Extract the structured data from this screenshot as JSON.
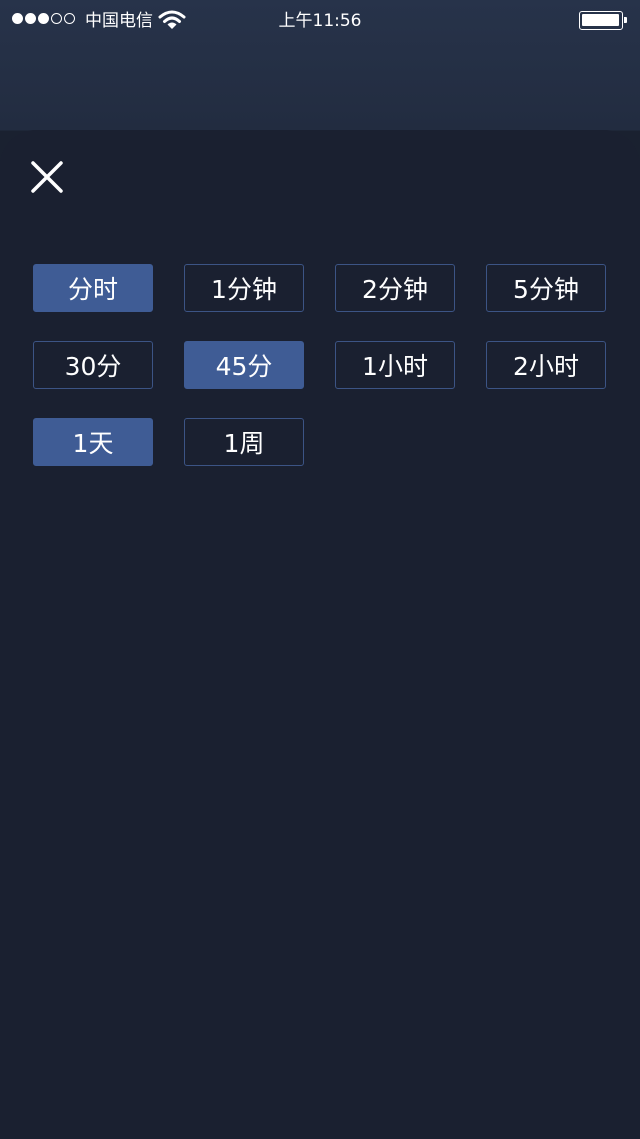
{
  "status_bar": {
    "carrier": "中国电信",
    "time": "上午11:56",
    "signal_strength_filled": 3,
    "signal_strength_total": 5,
    "battery_level": 1.0
  },
  "close_icon": "close-icon",
  "periods": [
    {
      "label": "分时",
      "selected": true
    },
    {
      "label": "1分钟",
      "selected": false
    },
    {
      "label": "2分钟",
      "selected": false
    },
    {
      "label": "5分钟",
      "selected": false
    },
    {
      "label": "30分",
      "selected": false
    },
    {
      "label": "45分",
      "selected": true
    },
    {
      "label": "1小时",
      "selected": false
    },
    {
      "label": "2小时",
      "selected": false
    },
    {
      "label": "1天",
      "selected": true
    },
    {
      "label": "1周",
      "selected": false
    }
  ],
  "colors": {
    "selected_bg": "#3f5c95",
    "border": "#3c5485",
    "sheet_bg": "#1a2030"
  }
}
